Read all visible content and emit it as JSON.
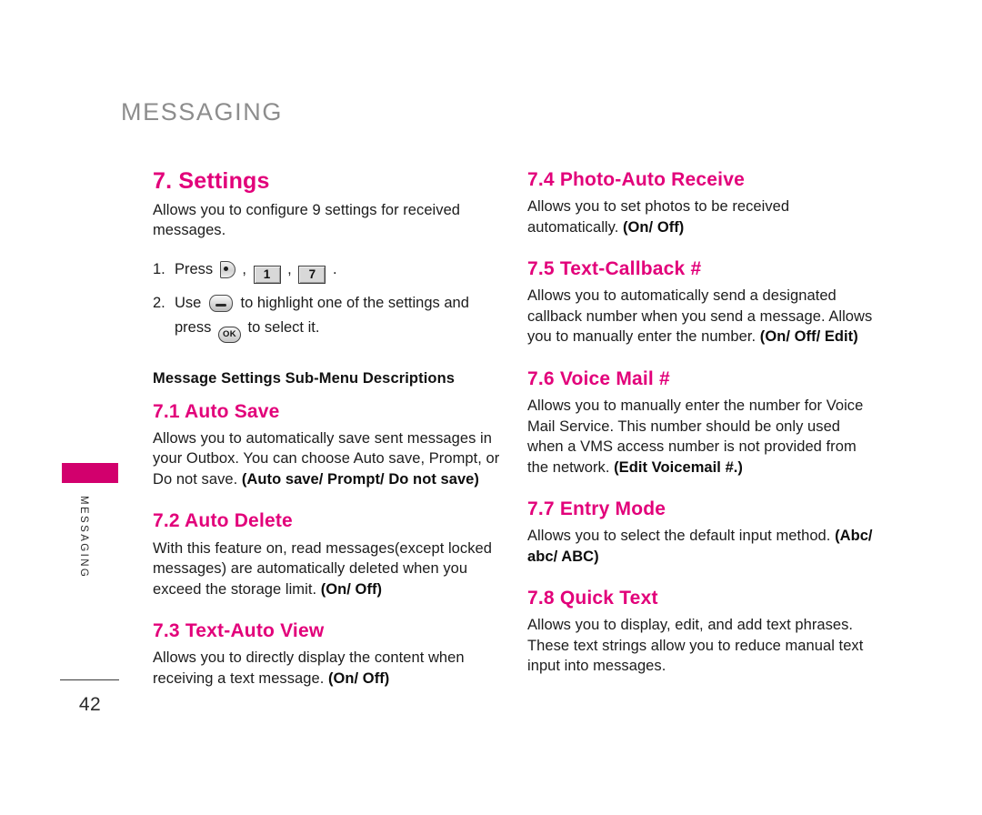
{
  "document": {
    "running_head": "MESSAGING",
    "page_number": "42",
    "side_tab_label": "MESSAGING"
  },
  "colors": {
    "heading_magenta": "#e2007a",
    "tab_magenta": "#d2006d",
    "running_head_gray": "#8d8d8d",
    "body_text": "#1c1c1c"
  },
  "left_column": {
    "section": {
      "title": "7. Settings",
      "intro": "Allows you to configure 9 settings for received messages.",
      "steps": [
        {
          "number": "1.",
          "lead": "Press",
          "keys": [
            {
              "name": "menu-key",
              "label": ""
            },
            {
              "name": "key-1",
              "label": "1"
            },
            {
              "name": "key-7",
              "label": "7"
            }
          ],
          "separator": ",",
          "terminator": "."
        },
        {
          "number": "2.",
          "lead": "Use",
          "nav_key": {
            "name": "navigation-key",
            "label": ""
          },
          "middle": "to highlight one of the settings and",
          "press_word": "press",
          "ok_key": {
            "name": "ok-key",
            "label": "OK"
          },
          "tail": "to select it."
        }
      ],
      "group_title": "Message Settings Sub-Menu Descriptions"
    },
    "subsections": [
      {
        "title": "7.1 Auto Save",
        "body": "Allows you to automatically save sent messages in your Outbox. You can choose Auto save, Prompt, or Do not save.",
        "options": "(Auto save/ Prompt/ Do not save)"
      },
      {
        "title": "7.2 Auto Delete",
        "body": "With this feature on, read messages(except locked messages) are automatically deleted when you exceed the storage limit.",
        "options": "(On/ Off)"
      },
      {
        "title": "7.3 Text-Auto View",
        "body": "Allows you to directly display the content when receiving a text message.",
        "options": "(On/ Off)"
      }
    ]
  },
  "right_column": {
    "subsections": [
      {
        "title": "7.4 Photo-Auto Receive",
        "body": "Allows you to set photos to be received automatically.",
        "options": "(On/ Off)"
      },
      {
        "title": "7.5 Text-Callback #",
        "body": "Allows you to automatically send a designated callback number when you send a message. Allows you to manually enter the number.",
        "options": "(On/ Off/ Edit)"
      },
      {
        "title": "7.6 Voice Mail #",
        "body": "Allows you to manually enter the number for Voice Mail Service. This number should be only used when a VMS access number is not provided from the network.",
        "options": "(Edit Voicemail #.)"
      },
      {
        "title": "7.7 Entry Mode",
        "body": "Allows you to select the default input method.",
        "options": "(Abc/ abc/ ABC)"
      },
      {
        "title": "7.8 Quick Text",
        "body": "Allows you to display, edit, and add text phrases. These text strings allow you to reduce manual text input into messages.",
        "options": ""
      }
    ]
  }
}
